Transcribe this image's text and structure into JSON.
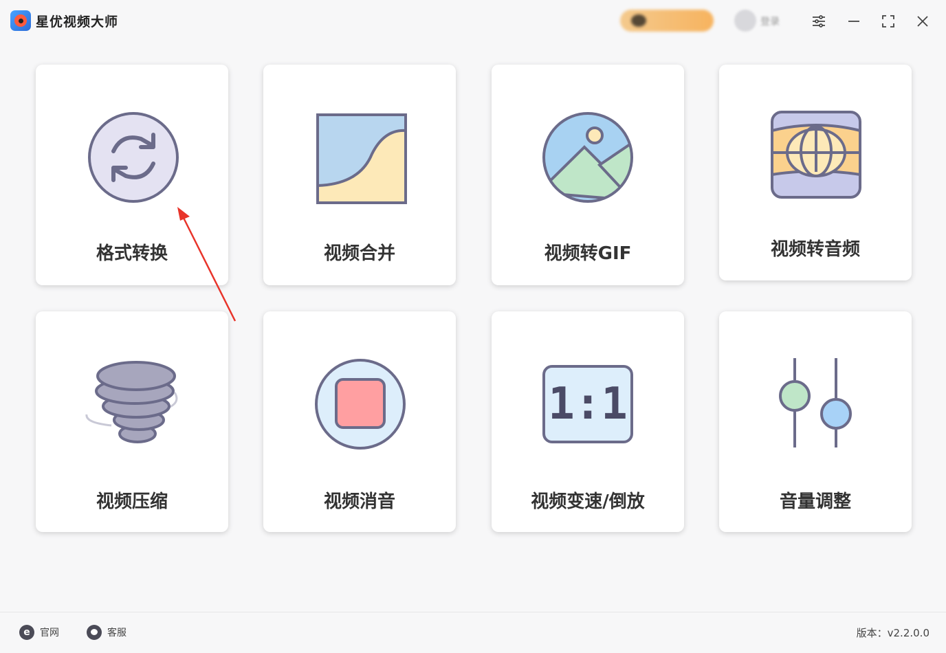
{
  "app": {
    "title": "星优视频大师"
  },
  "header": {
    "login_text": "登录"
  },
  "tools": [
    {
      "label": "格式转换",
      "icon": "format-convert-icon"
    },
    {
      "label": "视频合并",
      "icon": "video-merge-icon"
    },
    {
      "label": "视频转GIF",
      "icon": "image-landscape-icon"
    },
    {
      "label": "视频转音频",
      "icon": "panorama-icon"
    },
    {
      "label": "视频压缩",
      "icon": "tornado-icon"
    },
    {
      "label": "视频消音",
      "icon": "stop-icon"
    },
    {
      "label": "视频变速/倒放",
      "icon": "ratio-icon"
    },
    {
      "label": "音量调整",
      "icon": "sliders-icon"
    }
  ],
  "ratio_text": "1:1",
  "footer": {
    "website_label": "官网",
    "support_label": "客服",
    "version_label": "版本：v2.2.0.0"
  },
  "colors": {
    "card_bg": "#ffffff",
    "icon_stroke": "#6b6b8a",
    "accent_red": "#e8342a"
  }
}
